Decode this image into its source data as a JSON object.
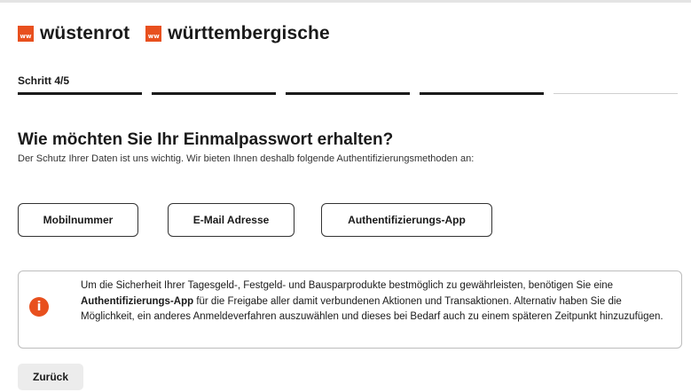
{
  "brand": {
    "logo1": {
      "mark": "ww",
      "name": "wüstenrot"
    },
    "logo2": {
      "mark": "ww",
      "name": "württembergische"
    },
    "accent_color": "#e8501e"
  },
  "progress": {
    "label": "Schritt 4/5",
    "current_step": 4,
    "total_steps": 5
  },
  "heading": {
    "title": "Wie möchten Sie Ihr Einmalpasswort erhalten?",
    "subtitle": "Der Schutz Ihrer Daten ist uns wichtig. Wir bieten Ihnen deshalb folgende Authentifizierungsmethoden an:"
  },
  "methods": [
    {
      "label": "Mobilnummer"
    },
    {
      "label": "E-Mail Adresse"
    },
    {
      "label": "Authentifizierungs-App"
    }
  ],
  "info": {
    "icon": "info-icon",
    "text_before": "Um die Sicherheit Ihrer Tagesgeld-, Festgeld- und Bausparprodukte bestmöglich zu gewährleisten, benötigen Sie eine ",
    "text_bold": "Authentifizierungs-App",
    "text_after": " für die Freigabe aller damit verbundenen Aktionen und Transaktionen. Alternativ haben Sie die Möglichkeit, ein anderes Anmeldeverfahren auszuwählen und dieses bei Bedarf auch zu einem späteren Zeitpunkt hinzuzufügen."
  },
  "actions": {
    "back_label": "Zurück"
  }
}
